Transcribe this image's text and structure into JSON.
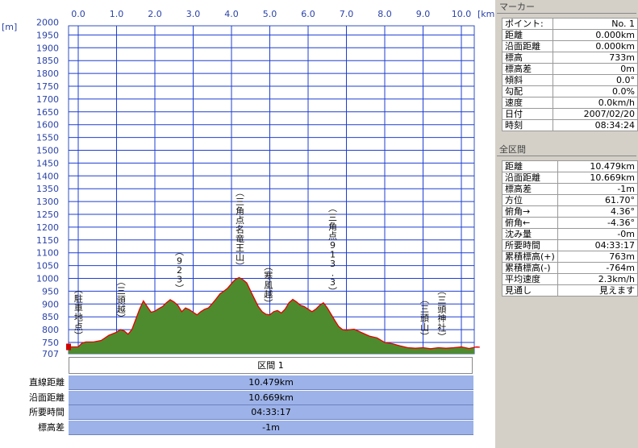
{
  "chart_data": {
    "type": "area",
    "x_unit": "[km]",
    "y_unit": "[m]",
    "x_ticks": [
      "0.0",
      "1.0",
      "2.0",
      "3.0",
      "4.0",
      "5.0",
      "6.0",
      "7.0",
      "8.0",
      "9.0",
      "10.0"
    ],
    "y_ticks": [
      "2000",
      "1950",
      "1900",
      "1850",
      "1800",
      "1750",
      "1700",
      "1650",
      "1600",
      "1550",
      "1500",
      "1450",
      "1400",
      "1350",
      "1300",
      "1250",
      "1200",
      "1150",
      "1100",
      "1050",
      "1000",
      "950",
      "900",
      "850",
      "800",
      "750",
      "707"
    ],
    "xlim": [
      0,
      10.6
    ],
    "ylim": [
      707,
      2000
    ],
    "profile": {
      "x": [
        0.0,
        0.1,
        0.2,
        0.4,
        0.6,
        0.8,
        1.0,
        1.1,
        1.2,
        1.3,
        1.4,
        1.5,
        1.6,
        1.7,
        1.8,
        1.9,
        2.0,
        2.1,
        2.2,
        2.3,
        2.4,
        2.5,
        2.6,
        2.7,
        2.8,
        2.9,
        3.0,
        3.1,
        3.2,
        3.3,
        3.4,
        3.5,
        3.6,
        3.7,
        3.8,
        3.9,
        4.0,
        4.1,
        4.2,
        4.3,
        4.4,
        4.5,
        4.6,
        4.7,
        4.8,
        4.9,
        5.0,
        5.1,
        5.2,
        5.3,
        5.4,
        5.5,
        5.6,
        5.7,
        5.8,
        5.9,
        6.0,
        6.1,
        6.2,
        6.3,
        6.4,
        6.5,
        6.6,
        6.7,
        6.8,
        6.9,
        7.0,
        7.2,
        7.4,
        7.6,
        7.8,
        8.0,
        8.2,
        8.4,
        8.6,
        8.8,
        9.0,
        9.2,
        9.4,
        9.6,
        9.8,
        10.0,
        10.2,
        10.4,
        10.479
      ],
      "y": [
        733,
        748,
        752,
        752,
        758,
        778,
        790,
        800,
        795,
        782,
        800,
        840,
        880,
        912,
        890,
        868,
        872,
        882,
        890,
        905,
        917,
        908,
        895,
        870,
        885,
        878,
        868,
        858,
        870,
        880,
        885,
        902,
        920,
        940,
        950,
        962,
        980,
        996,
        1003,
        995,
        982,
        950,
        920,
        890,
        870,
        860,
        858,
        870,
        875,
        865,
        880,
        905,
        918,
        908,
        895,
        890,
        880,
        870,
        880,
        895,
        905,
        885,
        860,
        835,
        812,
        800,
        798,
        802,
        788,
        775,
        768,
        750,
        745,
        737,
        730,
        728,
        730,
        726,
        730,
        728,
        730,
        733,
        727,
        733,
        732
      ]
    },
    "annotations": [
      {
        "text": "駐車地点",
        "x": 0.05,
        "y": 733
      },
      {
        "text": "三頭越",
        "x": 1.08,
        "y": 800
      },
      {
        "text": "923",
        "x": 2.6,
        "y": 917
      },
      {
        "text": "三角点名竜王山",
        "x": 4.18,
        "y": 1003
      },
      {
        "text": "寒風越",
        "x": 4.92,
        "y": 858
      },
      {
        "text": "三角点913.3",
        "x": 6.6,
        "y": 905
      },
      {
        "text": "三頭山",
        "x": 9.0,
        "y": 730
      },
      {
        "text": "三頭神社",
        "x": 9.45,
        "y": 728
      }
    ],
    "colors": {
      "fill": "#4e8b2e",
      "line": "#e80000",
      "grid": "#1f3fd0",
      "labels": "#2b43a8"
    }
  },
  "marker_panel": {
    "title": "マーカー",
    "rows": [
      {
        "label": "ポイント:",
        "value": "No. 1"
      },
      {
        "label": "距離",
        "value": "0.000km"
      },
      {
        "label": "沿面距離",
        "value": "0.000km"
      },
      {
        "label": "標高",
        "value": "733m"
      },
      {
        "label": "標高差",
        "value": "0m"
      },
      {
        "label": "傾斜",
        "value": "0.0°"
      },
      {
        "label": "勾配",
        "value": "0.0%"
      },
      {
        "label": "速度",
        "value": "0.0km/h"
      },
      {
        "label": "日付",
        "value": "2007/02/20"
      },
      {
        "label": "時刻",
        "value": "08:34:24"
      }
    ]
  },
  "section_panel": {
    "title": "全区間",
    "rows": [
      {
        "label": "距離",
        "value": "10.479km"
      },
      {
        "label": "沿面距離",
        "value": "10.669km"
      },
      {
        "label": "標高差",
        "value": "-1m"
      },
      {
        "label": "方位",
        "value": "61.70°"
      },
      {
        "label": "俯角→",
        "value": "4.36°"
      },
      {
        "label": "俯角←",
        "value": "-4.36°"
      },
      {
        "label": "沈み量",
        "value": "-0m"
      },
      {
        "label": "所要時間",
        "value": "04:33:17"
      },
      {
        "label": "累積標高(+)",
        "value": "763m"
      },
      {
        "label": "累積標高(-)",
        "value": "-764m"
      },
      {
        "label": "平均速度",
        "value": "2.3km/h"
      },
      {
        "label": "見通し",
        "value": "見えます"
      }
    ]
  },
  "segment": {
    "header": "区間 1",
    "rows": [
      {
        "label": "直線距離",
        "value": "10.479km"
      },
      {
        "label": "沿面距離",
        "value": "10.669km"
      },
      {
        "label": "所要時間",
        "value": "04:33:17"
      },
      {
        "label": "標高差",
        "value": "-1m"
      }
    ]
  }
}
